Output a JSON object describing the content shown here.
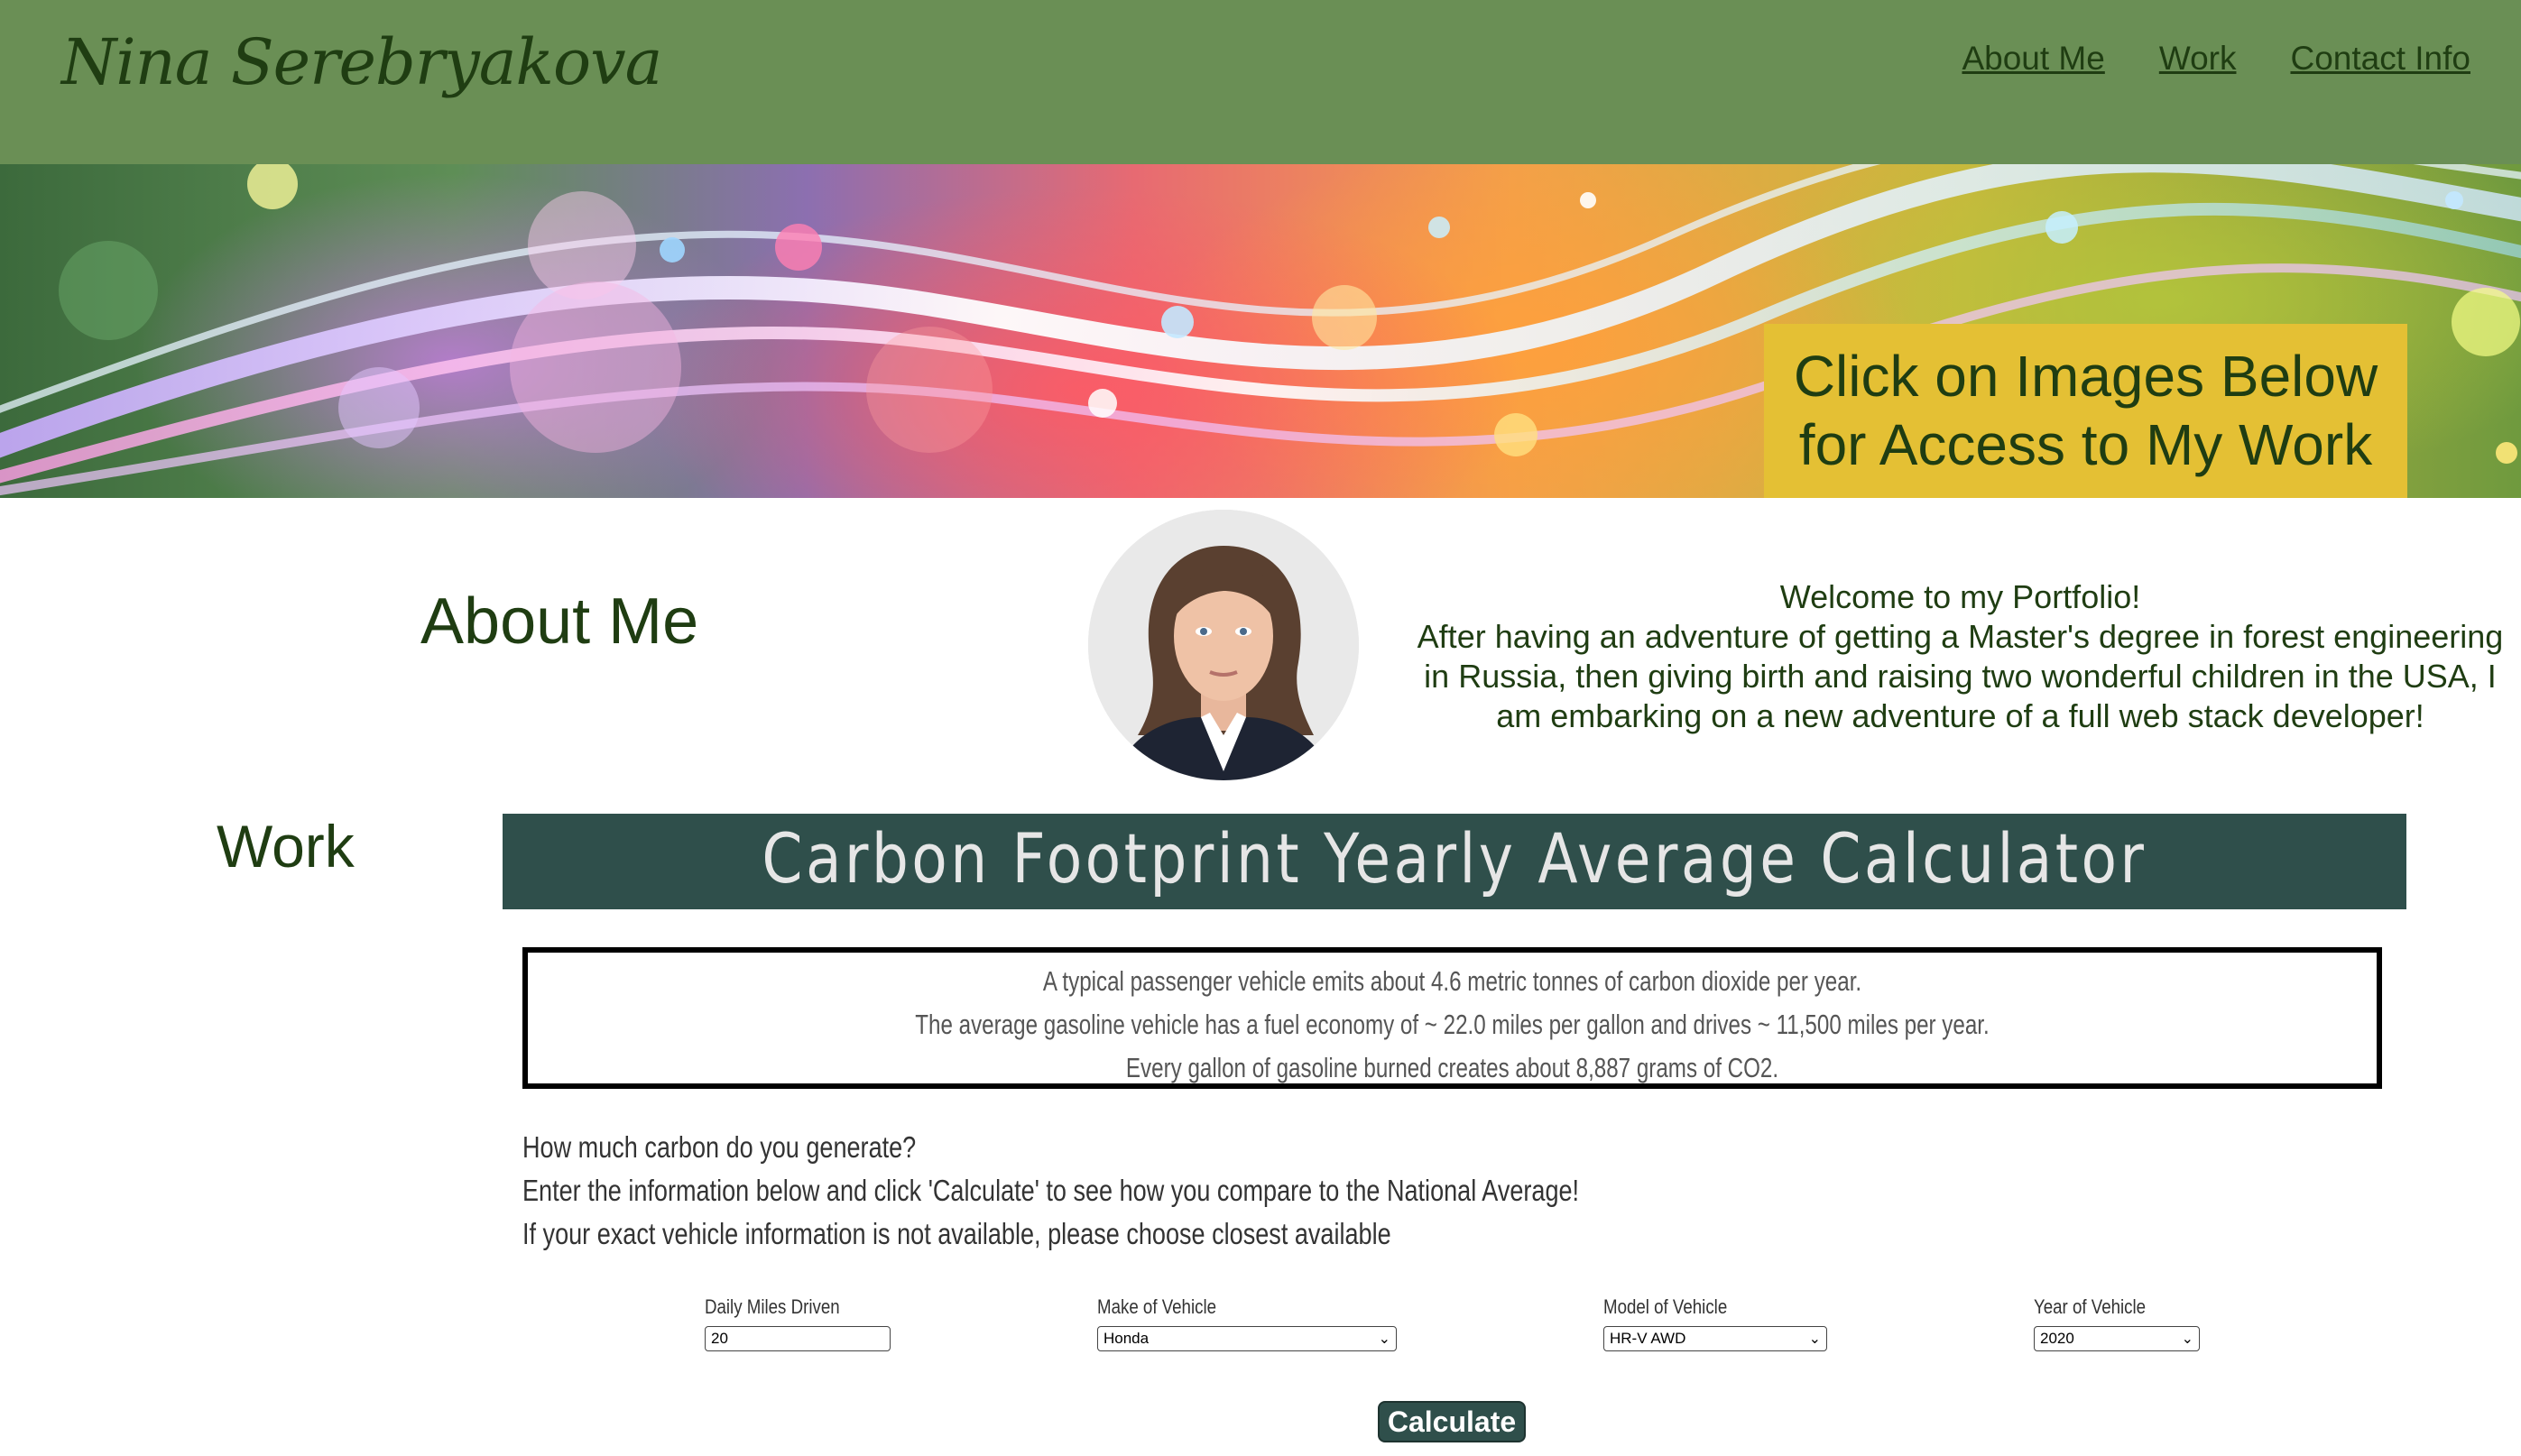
{
  "header": {
    "brand": "Nina Serebryakova",
    "nav": [
      "About Me",
      "Work",
      "Contact Info"
    ]
  },
  "banner": {
    "caption_line1": "Click on Images Below",
    "caption_line2": "for Access to My Work"
  },
  "about": {
    "heading": "About Me",
    "welcome_title": "Welcome to my Portfolio!",
    "welcome_body": "After having an adventure of getting a Master's degree in forest engineering in Russia, then giving birth and raising two wonderful children in the USA, I am embarking on a new adventure of a full web stack developer!"
  },
  "work": {
    "heading": "Work",
    "calculator_title": "Carbon Footprint Yearly Average Calculator",
    "facts": [
      "A typical passenger vehicle emits about 4.6 metric tonnes of carbon dioxide per year.",
      "The average gasoline vehicle has a fuel economy of ~ 22.0 miles per gallon and drives ~ 11,500 miles per year.",
      "Every gallon of gasoline burned creates about 8,887 grams of CO2."
    ],
    "intro": [
      "How much carbon do you generate?",
      "Enter the information below and click 'Calculate' to see how you compare to the National Average!",
      "If your exact vehicle information is not available, please choose closest available"
    ],
    "fields": {
      "miles_label": "Daily Miles Driven",
      "miles_value": "20",
      "make_label": "Make of Vehicle",
      "make_value": "Honda",
      "model_label": "Model of Vehicle",
      "model_value": "HR-V AWD",
      "year_label": "Year of Vehicle",
      "year_value": "2020"
    },
    "calculate_label": "Calculate"
  },
  "colors": {
    "header_bg": "#6a8f55",
    "text_dark_green": "#1f3d12",
    "caption_bg": "#e4c034",
    "calc_title_bg": "#2f4f4b"
  }
}
